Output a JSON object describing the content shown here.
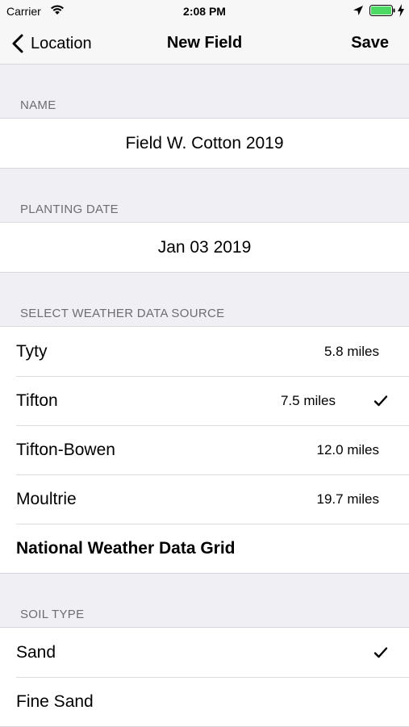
{
  "status_bar": {
    "carrier": "Carrier",
    "time": "2:08 PM",
    "battery_color": "#4cd964"
  },
  "nav": {
    "back_label": "Location",
    "title": "New Field",
    "save_label": "Save"
  },
  "name_section": {
    "header": "NAME",
    "value": "Field W. Cotton 2019"
  },
  "planting_section": {
    "header": "PLANTING DATE",
    "value": "Jan 03 2019"
  },
  "weather_section": {
    "header": "SELECT WEATHER DATA SOURCE",
    "items": [
      {
        "label": "Tyty",
        "distance": "5.8 miles",
        "selected": false
      },
      {
        "label": "Tifton",
        "distance": "7.5 miles",
        "selected": true
      },
      {
        "label": "Tifton-Bowen",
        "distance": "12.0 miles",
        "selected": false
      },
      {
        "label": "Moultrie",
        "distance": "19.7 miles",
        "selected": false
      },
      {
        "label": "National Weather Data Grid",
        "distance": "",
        "selected": false
      }
    ]
  },
  "soil_section": {
    "header": "SOIL TYPE",
    "items": [
      {
        "label": "Sand",
        "selected": true
      },
      {
        "label": "Fine Sand",
        "selected": false
      }
    ]
  }
}
